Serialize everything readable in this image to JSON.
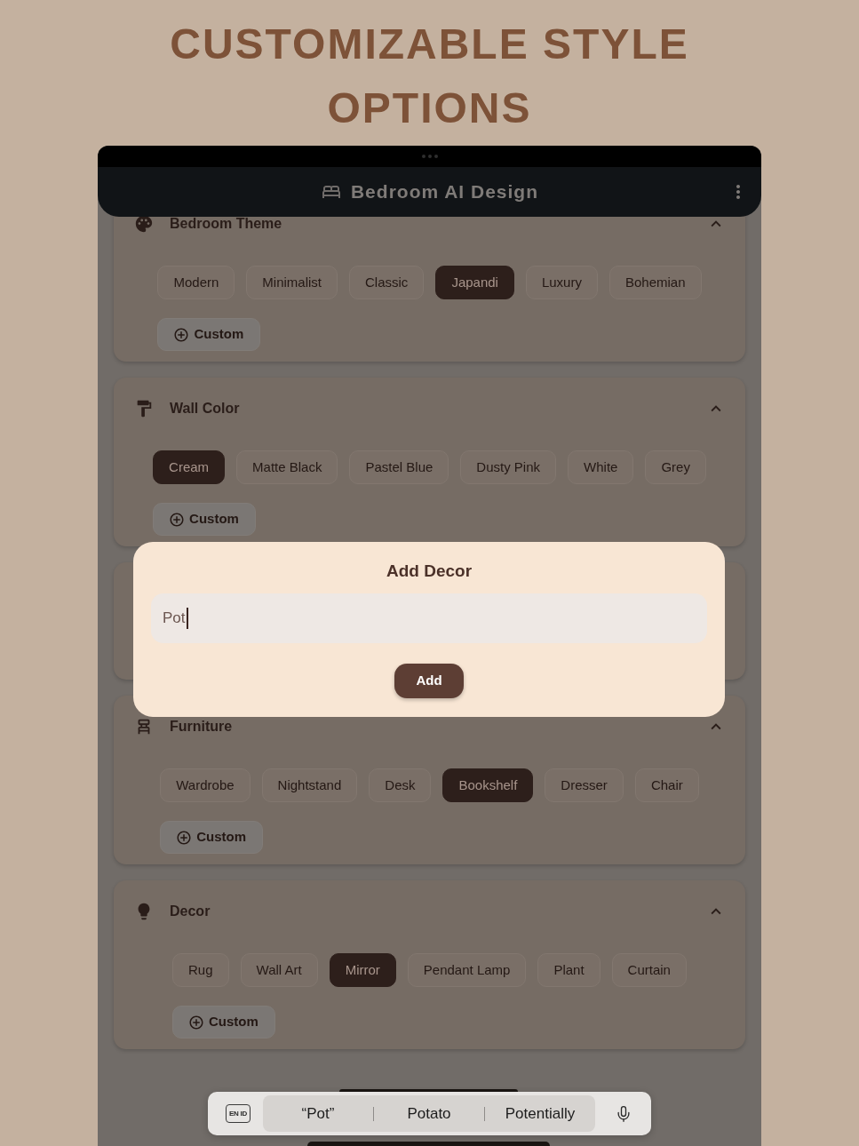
{
  "page_title": "CUSTOMIZABLE STYLE OPTIONS",
  "app_bar": {
    "title": "Bedroom AI Design"
  },
  "sections": [
    {
      "kind": "options",
      "title": "Bedroom Theme",
      "expanded": true,
      "options": [
        {
          "label": "Modern",
          "selected": false
        },
        {
          "label": "Minimalist",
          "selected": false
        },
        {
          "label": "Classic",
          "selected": false
        },
        {
          "label": "Japandi",
          "selected": true
        },
        {
          "label": "Luxury",
          "selected": false
        },
        {
          "label": "Bohemian",
          "selected": false
        }
      ],
      "custom_label": "Custom"
    },
    {
      "kind": "options",
      "title": "Wall Color",
      "expanded": true,
      "options": [
        {
          "label": "Cream",
          "selected": true
        },
        {
          "label": "Matte Black",
          "selected": false
        },
        {
          "label": "Pastel Blue",
          "selected": false
        },
        {
          "label": "Dusty Pink",
          "selected": false
        },
        {
          "label": "White",
          "selected": false
        },
        {
          "label": "Grey",
          "selected": false
        }
      ],
      "custom_label": "Custom"
    },
    {
      "kind": "covered"
    },
    {
      "kind": "options",
      "title": "Furniture",
      "expanded": true,
      "options": [
        {
          "label": "Wardrobe",
          "selected": false
        },
        {
          "label": "Nightstand",
          "selected": false
        },
        {
          "label": "Desk",
          "selected": false
        },
        {
          "label": "Bookshelf",
          "selected": true
        },
        {
          "label": "Dresser",
          "selected": false
        },
        {
          "label": "Chair",
          "selected": false
        }
      ],
      "custom_label": "Custom"
    },
    {
      "kind": "options",
      "title": "Decor",
      "expanded": true,
      "options": [
        {
          "label": "Rug",
          "selected": false
        },
        {
          "label": "Wall Art",
          "selected": false
        },
        {
          "label": "Mirror",
          "selected": true
        },
        {
          "label": "Pendant Lamp",
          "selected": false
        },
        {
          "label": "Plant",
          "selected": false
        },
        {
          "label": "Curtain",
          "selected": false
        }
      ],
      "custom_label": "Custom"
    }
  ],
  "dialog": {
    "title": "Add Decor",
    "input": {
      "value": "Pot"
    },
    "button": "Add"
  },
  "keyboard_bar": {
    "language": "EN ID",
    "suggestions": [
      "“Pot”",
      "Potato",
      "Potentially"
    ]
  }
}
